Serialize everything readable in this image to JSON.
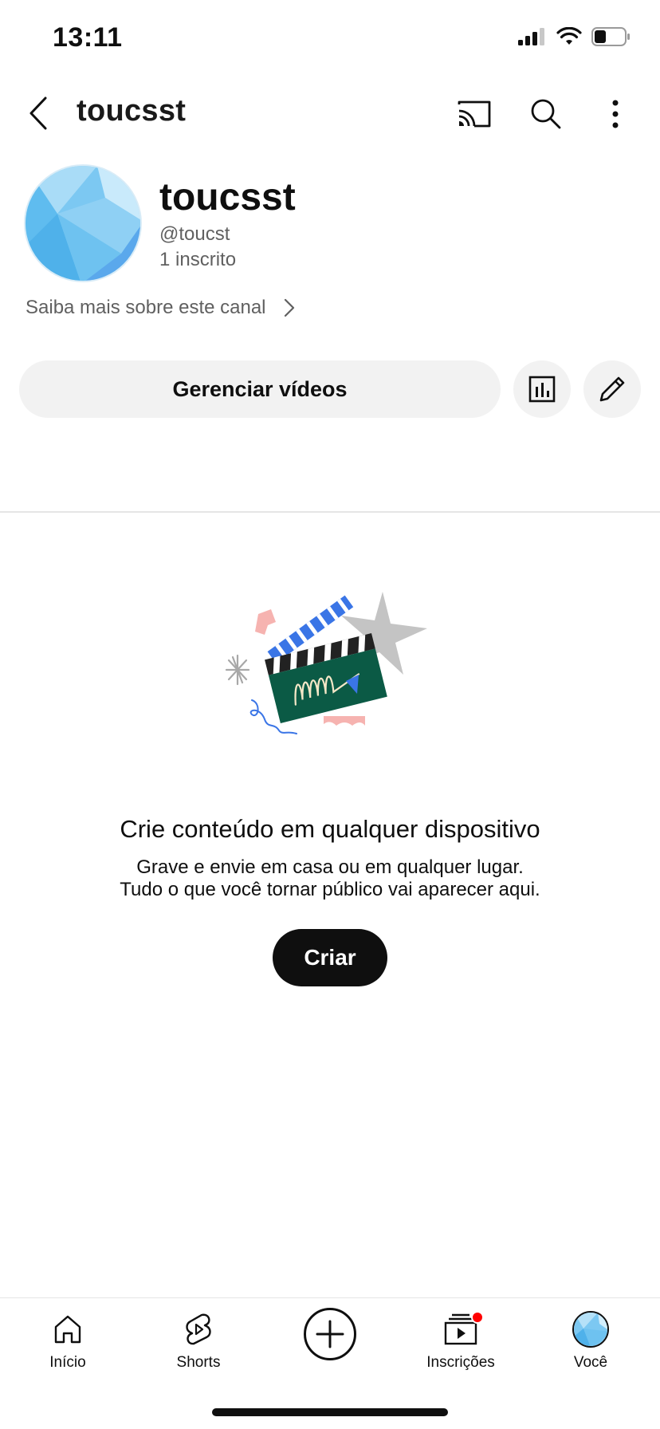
{
  "status_bar": {
    "time": "13:11"
  },
  "header": {
    "title": "toucsst"
  },
  "channel": {
    "name": "toucsst",
    "handle": "@toucst",
    "subscribers": "1 inscrito",
    "about_link": "Saiba mais sobre este canal"
  },
  "actions": {
    "manage_videos": "Gerenciar vídeos"
  },
  "empty_state": {
    "title": "Crie conteúdo em qualquer dispositivo",
    "line1": "Grave e envie em casa ou em qualquer lugar.",
    "line2": "Tudo o que você tornar público vai aparecer aqui.",
    "create_button": "Criar"
  },
  "bottom_nav": {
    "home": "Início",
    "shorts": "Shorts",
    "subscriptions": "Inscrições",
    "you": "Você"
  },
  "colors": {
    "accent_red": "#ff0000",
    "illustration_green": "#0b5a45",
    "illustration_blue": "#3a75e6",
    "illustration_pink": "#f6b3b0"
  }
}
